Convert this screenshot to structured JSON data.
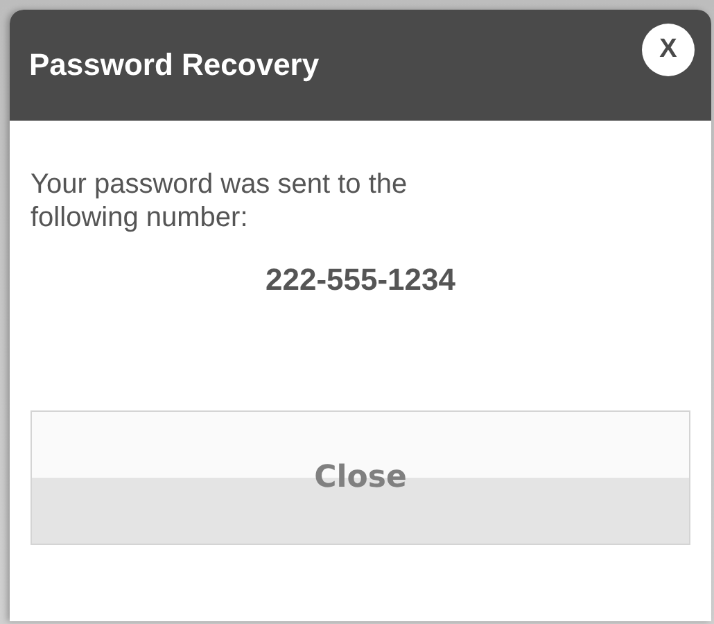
{
  "dialog": {
    "title": "Password Recovery",
    "close_icon_label": "X",
    "message": "Your password was sent to the following number:",
    "phone_number": "222-555-1234",
    "buttons": [
      "Close"
    ]
  }
}
